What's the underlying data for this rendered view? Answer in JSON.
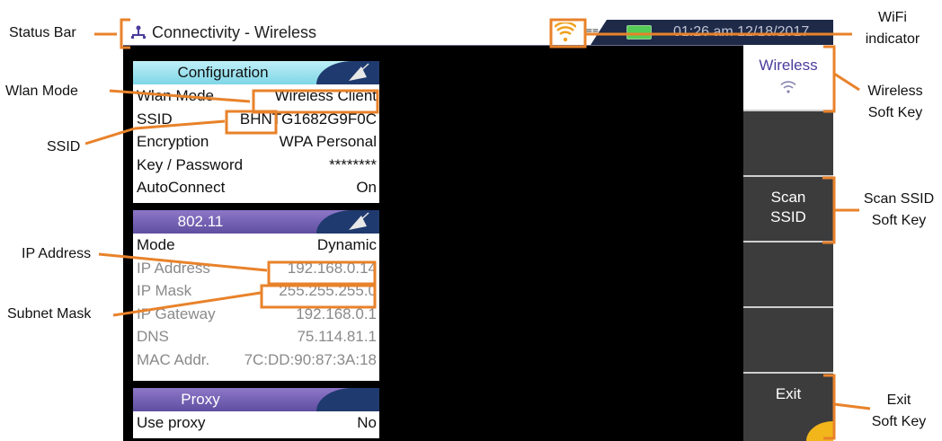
{
  "status_bar": {
    "app_icon": "network-icon",
    "title": "Connectivity - Wireless",
    "wifi_icon": "wifi-icon",
    "network_indicator": "≡≡",
    "battery_icon": "battery-icon",
    "datetime": "01:26 am 12/18/2017"
  },
  "configuration": {
    "header": "Configuration",
    "rows": [
      {
        "label": "Wlan Mode",
        "value": "Wireless Client"
      },
      {
        "label": "SSID",
        "value": "BHNTG1682G9F0C"
      },
      {
        "label": "Encryption",
        "value": "WPA Personal"
      },
      {
        "label": "Key / Password",
        "value": "********"
      },
      {
        "label": "AutoConnect",
        "value": "On"
      }
    ]
  },
  "wifi_80211": {
    "header": "802.11",
    "rows": [
      {
        "label": "Mode",
        "value": "Dynamic"
      },
      {
        "label": "IP Address",
        "value": "192.168.0.14"
      },
      {
        "label": "IP Mask",
        "value": "255.255.255.0"
      },
      {
        "label": "IP Gateway",
        "value": "192.168.0.1"
      },
      {
        "label": "DNS",
        "value": "75.114.81.1"
      },
      {
        "label": "MAC Addr.",
        "value": "7C:DD:90:87:3A:18"
      }
    ]
  },
  "proxy": {
    "header": "Proxy",
    "rows": [
      {
        "label": "Use proxy",
        "value": "No"
      }
    ]
  },
  "softkeys": [
    {
      "label": "Wireless",
      "icon": "wifi-icon"
    },
    {
      "label": ""
    },
    {
      "label": "Scan\nSSID"
    },
    {
      "label": ""
    },
    {
      "label": ""
    },
    {
      "label": "Exit",
      "icon": "back-arrow-icon"
    }
  ],
  "annotations": {
    "status_bar": "Status  Bar",
    "wlan_mode": "Wlan Mode",
    "ssid": "SSID",
    "ip_address": "IP Address",
    "subnet_mask": "Subnet Mask",
    "wifi_indicator": "WiFi\nindicator",
    "wireless_soft_key": "Wireless\nSoft Key",
    "scan_ssid_soft_key": "Scan SSID\nSoft Key",
    "exit_soft_key": "Exit\nSoft Key"
  },
  "colors": {
    "annotation_line": "#e8822a",
    "active_softkey_text": "#4a3d9c",
    "config_header": "#7fd6e6",
    "section_header": "#6a56aa"
  }
}
